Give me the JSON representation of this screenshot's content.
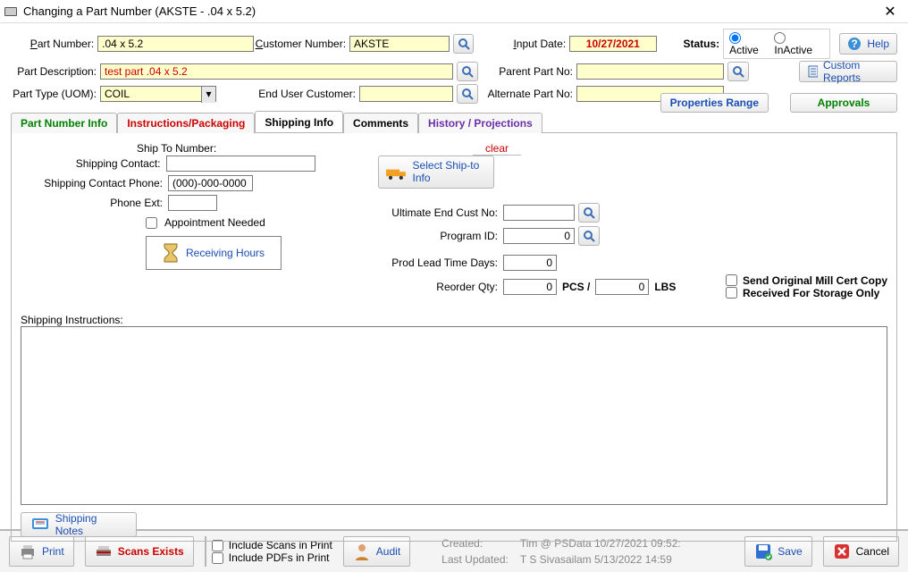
{
  "window": {
    "title": "Changing a Part Number  (AKSTE - .04 x 5.2)"
  },
  "header": {
    "partNumberLabel": "Part Number:",
    "partNumberValue": ".04 x 5.2",
    "customerNumberLabel": "Customer Number:",
    "customerNumberValue": "AKSTE",
    "inputDateLabel": "Input Date:",
    "inputDateValue": "10/27/2021",
    "statusLabel": "Status:",
    "activeLabel": "Active",
    "inactiveLabel": "InActive",
    "helpLabel": "Help",
    "partDescLabel": "Part Description:",
    "partDescValue": "test part .04 x 5.2",
    "parentPartLabel": "Parent Part No:",
    "parentPartValue": "",
    "customReportsLabel": "Custom Reports",
    "partTypeLabel": "Part Type (UOM):",
    "partTypeValue": "COIL",
    "endUserCustLabel": "End User Customer:",
    "endUserCustValue": "",
    "altPartLabel": "Alternate Part No:",
    "altPartValue": ""
  },
  "tabs": {
    "t1": "Part Number Info",
    "t2": "Instructions/Packaging",
    "t3": "Shipping Info",
    "t4": "Comments",
    "t5": "History / Projections",
    "propRange": "Properties Range",
    "approvals": "Approvals"
  },
  "shipping": {
    "shipToNumberLabel": "Ship To Number:",
    "clearLabel": "clear",
    "contactLabel": "Shipping Contact:",
    "contactValue": "",
    "contactPhoneLabel": "Shipping Contact Phone:",
    "contactPhoneValue": "(000)-000-0000",
    "phoneExtLabel": "Phone Ext:",
    "phoneExtValue": "",
    "appointmentLabel": "Appointment Needed",
    "receivingHoursLabel": "Receiving Hours",
    "selectShipToLabel": "Select Ship-to Info",
    "ultEndCustLabel": "Ultimate End Cust No:",
    "ultEndCustValue": "",
    "programIdLabel": "Program ID:",
    "programIdValue": "0",
    "prodLeadLabel": "Prod Lead Time Days:",
    "prodLeadValue": "0",
    "reorderLabel": "Reorder Qty:",
    "reorderValue": "0",
    "pcsLabel": "PCS /",
    "reorderValue2": "0",
    "lbsLabel": "LBS",
    "sendMillCertLabel": "Send Original Mill Cert Copy",
    "receivedStorageLabel": "Received For Storage Only",
    "instrLabel": "Shipping Instructions:",
    "shippingNotesLabel": "Shipping Notes"
  },
  "footer": {
    "printLabel": "Print",
    "scansLabel": "Scans Exists",
    "includeScansLabel": "Include Scans in Print",
    "includePdfsLabel": "Include PDFs in Print",
    "auditLabel": "Audit",
    "createdLabel": "Created:",
    "createdValue": "Tim @ PSData 10/27/2021 09:52:",
    "updatedLabel": "Last Updated:",
    "updatedValue": "T S Sivasailam 5/13/2022 14:59",
    "saveLabel": "Save",
    "cancelLabel": "Cancel"
  }
}
